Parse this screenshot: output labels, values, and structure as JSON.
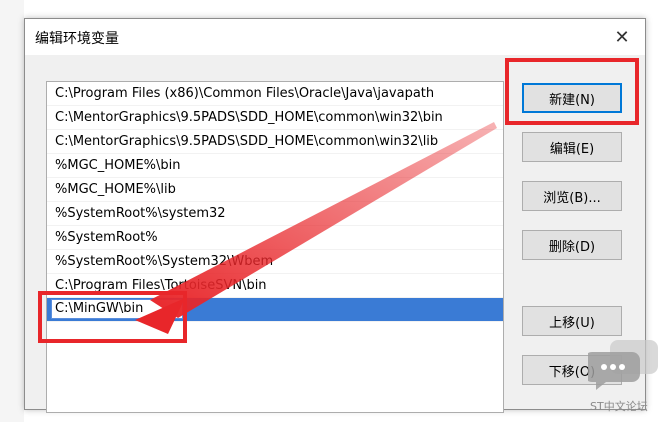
{
  "dialog": {
    "title": "编辑环境变量",
    "close_label": "✕"
  },
  "paths": [
    "C:\\Program Files (x86)\\Common Files\\Oracle\\Java\\javapath",
    "C:\\MentorGraphics\\9.5PADS\\SDD_HOME\\common\\win32\\bin",
    "C:\\MentorGraphics\\9.5PADS\\SDD_HOME\\common\\win32\\lib",
    "%MGC_HOME%\\bin",
    "%MGC_HOME%\\lib",
    "%SystemRoot%\\system32",
    "%SystemRoot%",
    "%SystemRoot%\\System32\\Wbem",
    "C:\\Program Files\\TortoiseSVN\\bin"
  ],
  "editing_value": "C:\\MinGW\\bin",
  "buttons": {
    "new": "新建(N)",
    "edit": "编辑(E)",
    "browse": "浏览(B)...",
    "delete": "删除(D)",
    "move_up": "上移(U)",
    "move_down": "下移(O)"
  },
  "watermark": "ST中文论坛",
  "colors": {
    "highlight": "#e8262a",
    "selection": "#3a7bd5"
  }
}
